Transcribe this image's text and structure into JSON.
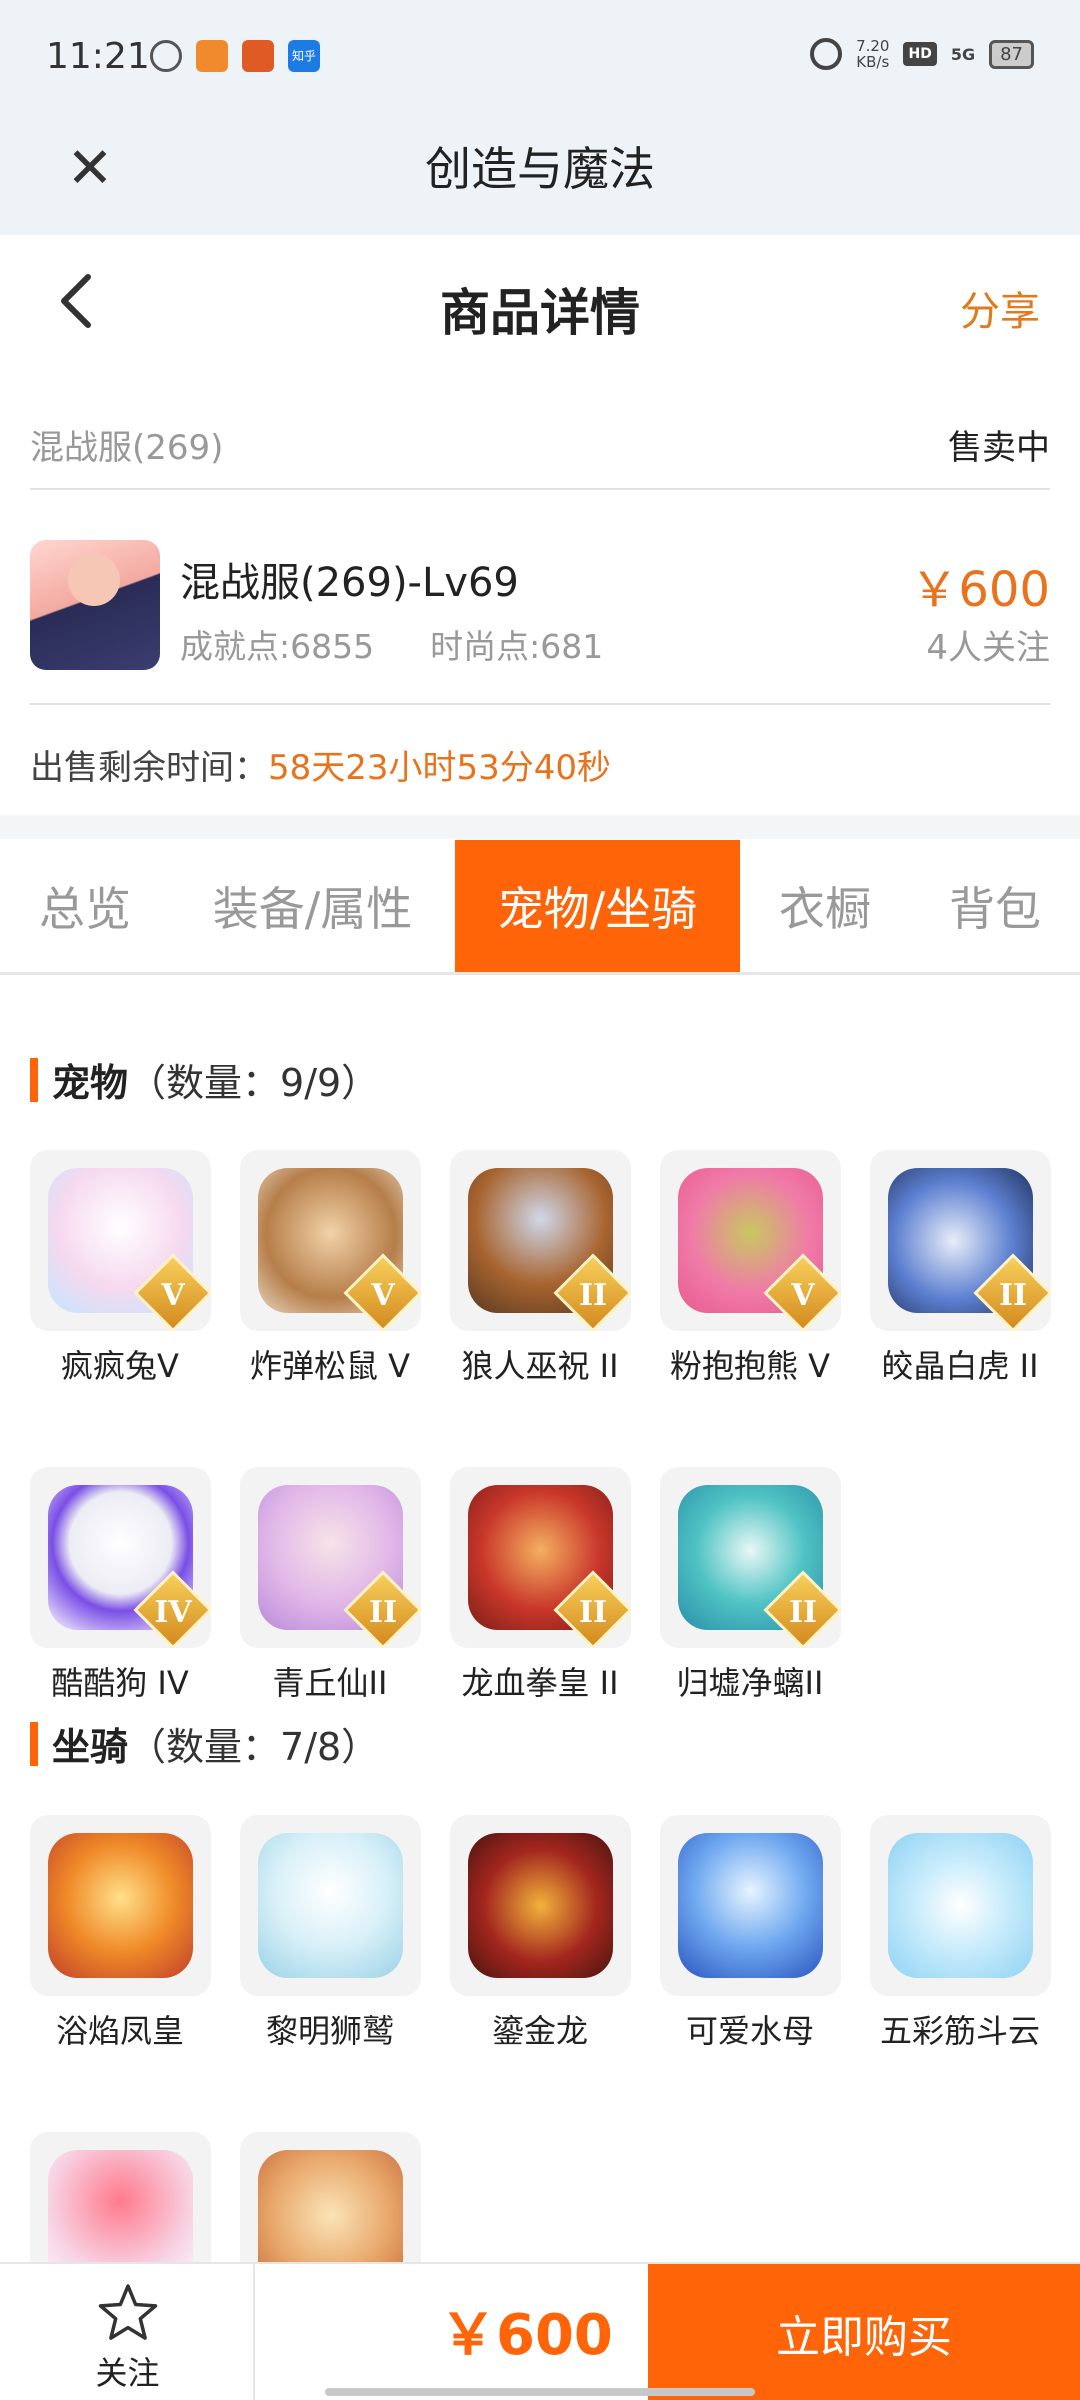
{
  "status_bar": {
    "time": "11:21",
    "zhihu": "知乎",
    "net_speed": "7.20",
    "net_unit": "KB/s",
    "hd": "HD",
    "network": "5G",
    "battery": "87"
  },
  "webview": {
    "title": "创造与魔法"
  },
  "header": {
    "title": "商品详情",
    "share": "分享"
  },
  "listing": {
    "server": "混战服(269)",
    "status": "售卖中",
    "title": "混战服(269)-Lv69",
    "achievement": "成就点:6855",
    "fashion": "时尚点:681",
    "price": "￥600",
    "watchers": "4人关注",
    "remain_label": "出售剩余时间：",
    "remain_value": "58天23小时53分40秒"
  },
  "tabs": [
    "总览",
    "装备/属性",
    "宠物/坐骑",
    "衣橱",
    "背包"
  ],
  "pets": {
    "name": "宠物",
    "count": "（数量：9/9）",
    "items": [
      {
        "label": "疯疯兔V",
        "badge": "V"
      },
      {
        "label": "炸弹松鼠 V",
        "badge": "V"
      },
      {
        "label": "狼人巫祝 II",
        "badge": "II"
      },
      {
        "label": "粉抱抱熊 V",
        "badge": "V"
      },
      {
        "label": "皎晶白虎 II",
        "badge": "II"
      },
      {
        "label": "酷酷狗 IV",
        "badge": "IV"
      },
      {
        "label": "青丘仙II",
        "badge": "II"
      },
      {
        "label": "龙血拳皇 II",
        "badge": "II"
      },
      {
        "label": "归墟净螭II",
        "badge": "II"
      }
    ]
  },
  "mounts": {
    "name": "坐骑",
    "count": "（数量：7/8）",
    "items": [
      {
        "label": "浴焰凤皇"
      },
      {
        "label": "黎明狮鹫"
      },
      {
        "label": "鎏金龙"
      },
      {
        "label": "可爱水母"
      },
      {
        "label": "五彩筋斗云"
      },
      {
        "label": ""
      },
      {
        "label": ""
      }
    ]
  },
  "bottom": {
    "follow": "关注",
    "price": "￥600",
    "buy": "立即购买"
  },
  "colors": {
    "accent": "#ff6408",
    "price": "#e8731c"
  }
}
